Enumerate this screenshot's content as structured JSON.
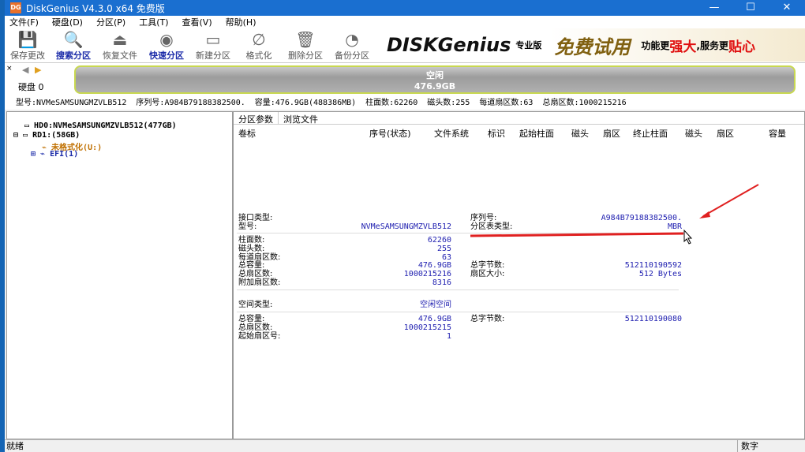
{
  "window": {
    "title": "DiskGenius V4.3.0 x64 免费版",
    "logo": "DG",
    "minimize": "—",
    "maximize": "☐",
    "close": "✕"
  },
  "menu": [
    "文件(F)",
    "硬盘(D)",
    "分区(P)",
    "工具(T)",
    "查看(V)",
    "帮助(H)"
  ],
  "toolbar": [
    {
      "label": "保存更改",
      "icon": "save-icon",
      "glyph": "💾",
      "hl": false
    },
    {
      "label": "搜索分区",
      "icon": "search-icon",
      "glyph": "🔍",
      "hl": true
    },
    {
      "label": "恢复文件",
      "icon": "recover-icon",
      "glyph": "⏏",
      "hl": false
    },
    {
      "label": "快速分区",
      "icon": "quick-partition-icon",
      "glyph": "◉",
      "hl": true
    },
    {
      "label": "新建分区",
      "icon": "new-partition-icon",
      "glyph": "▭",
      "hl": false
    },
    {
      "label": "格式化",
      "icon": "format-icon",
      "glyph": "∅",
      "hl": false
    },
    {
      "label": "删除分区",
      "icon": "delete-icon",
      "glyph": "🗑",
      "hl": false
    },
    {
      "label": "备份分区",
      "icon": "backup-icon",
      "glyph": "◔",
      "hl": false
    }
  ],
  "banner": {
    "brand": "DISKGenius",
    "edition": "专业版",
    "promo": "免费试用",
    "slogan1": "功能更",
    "slogan2": "强大",
    "slogan3": ",服务更",
    "slogan4": "贴心"
  },
  "disk": {
    "label": "硬盘 0",
    "bar_title": "空闲",
    "bar_size": "476.9GB"
  },
  "info": [
    "型号:NVMeSAMSUNGMZVLB512",
    "序列号:A984B79188382500.",
    "容量:476.9GB(488386MB)",
    "柱面数:62260",
    "磁头数:255",
    "每道扇区数:63",
    "总扇区数:1000215216"
  ],
  "tree": [
    "HD0:NVMeSAMSUNGMZVLB512(477GB)",
    "RD1:(58GB)",
    "未格式化(U:)",
    "EFI(1)"
  ],
  "tabs": [
    "分区参数",
    "浏览文件"
  ],
  "columns": [
    "卷标",
    "序号(状态)",
    "文件系统",
    "标识",
    "起始柱面",
    "磁头",
    "扇区",
    "终止柱面",
    "磁头",
    "扇区",
    "容量"
  ],
  "details": {
    "interface_label": "接口类型:",
    "model_label": "型号:",
    "model": "NVMeSAMSUNGMZVLB512",
    "serial_label": "序列号:",
    "serial": "A984B79188382500.",
    "pt_label": "分区表类型:",
    "pt": "MBR",
    "cyl_label": "柱面数:",
    "cyl": "62260",
    "heads_label": "磁头数:",
    "heads": "255",
    "spt_label": "每道扇区数:",
    "spt": "63",
    "cap_label": "总容量:",
    "cap": "476.9GB",
    "sectors_label": "总扇区数:",
    "sectors": "1000215216",
    "extra_label": "附加扇区数:",
    "extra": "8316",
    "bytes_label": "总字节数:",
    "bytes": "512110190592",
    "ssize_label": "扇区大小:",
    "ssize": "512 Bytes",
    "space_label": "空间类型:",
    "space": "空闲空间",
    "fcap_label": "总容量:",
    "fcap": "476.9GB",
    "fsec_label": "总扇区数:",
    "fsec": "1000215215",
    "fstart_label": "起始扇区号:",
    "fstart": "1",
    "fbytes_label": "总字节数:",
    "fbytes": "512110190080"
  },
  "status": {
    "left": "就绪",
    "right": "数字"
  },
  "colors": {
    "title": "#1a6fd0",
    "annotation": "#e02020",
    "value": "#2020b0"
  }
}
